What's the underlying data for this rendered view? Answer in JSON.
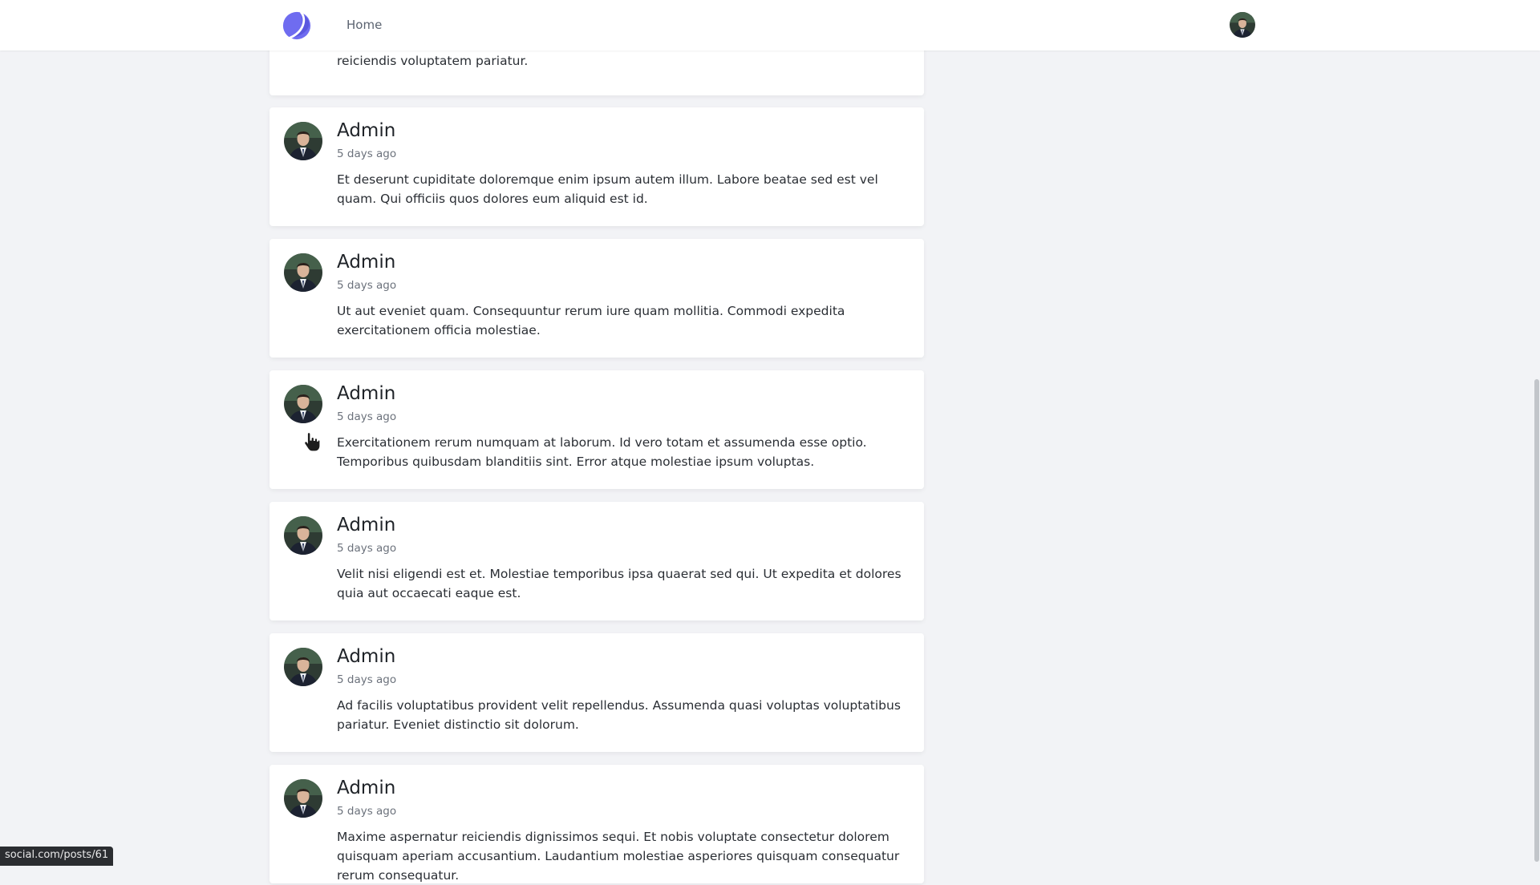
{
  "header": {
    "logo_icon": "crescent-logo-icon",
    "home_label": "Home",
    "avatar_icon": "user-avatar-icon"
  },
  "feed": {
    "partial_post": {
      "body": "reiciendis voluptatem pariatur."
    },
    "posts": [
      {
        "author": "Admin",
        "time": "5 days ago",
        "body": "Et deserunt cupiditate doloremque enim ipsum autem illum. Labore beatae sed est vel quam. Qui officiis quos dolores eum aliquid est id."
      },
      {
        "author": "Admin",
        "time": "5 days ago",
        "body": "Ut aut eveniet quam. Consequuntur rerum iure quam mollitia. Commodi expedita exercitationem officia molestiae."
      },
      {
        "author": "Admin",
        "time": "5 days ago",
        "body": "Exercitationem rerum numquam at laborum. Id vero totam et assumenda esse optio. Temporibus quibusdam blanditiis sint. Error atque molestiae ipsum voluptas."
      },
      {
        "author": "Admin",
        "time": "5 days ago",
        "body": "Velit nisi eligendi est et. Molestiae temporibus ipsa quaerat sed qui. Ut expedita et dolores quia aut occaecati eaque est."
      },
      {
        "author": "Admin",
        "time": "5 days ago",
        "body": "Ad facilis voluptatibus provident velit repellendus. Assumenda quasi voluptas voluptatibus pariatur. Eveniet distinctio sit dolorum."
      },
      {
        "author": "Admin",
        "time": "5 days ago",
        "body": "Maxime aspernatur reiciendis dignissimos sequi. Et nobis voluptate consectetur dolorem quisquam aperiam accusantium. Laudantium molestiae asperiores quisquam consequatur rerum consequatur."
      }
    ]
  },
  "status_bar": {
    "url": "social.com/posts/61"
  },
  "colors": {
    "accent": "#6f6cf0",
    "page_background": "#f2f3f6",
    "card_background": "#ffffff"
  }
}
